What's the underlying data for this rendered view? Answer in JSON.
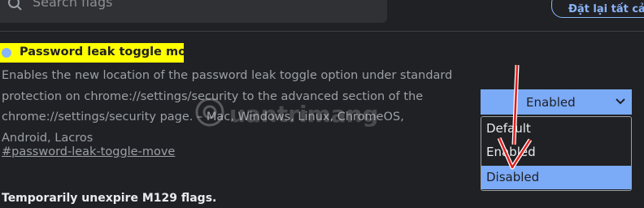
{
  "search": {
    "placeholder": "Search flags"
  },
  "header": {
    "reset_label": "Đặt lại tất cả"
  },
  "flag": {
    "title": "Password leak toggle move",
    "description": "Enables the new location of the password leak toggle option under standard protection on chrome://settings/security to the advanced section of the chrome://settings/security page. – Mac, Windows, Linux, ChromeOS, Android, Lacros",
    "link": "#password-leak-toggle-move",
    "select": {
      "value": "Enabled",
      "options": [
        "Default",
        "Enabled",
        "Disabled"
      ],
      "highlighted": "Disabled"
    }
  },
  "next_flag": {
    "title": "Temporarily unexpire M129 flags."
  },
  "watermark": {
    "text": "uantrimang"
  },
  "colors": {
    "background": "#202124",
    "accent": "#8ab4f8",
    "highlight": "#ffff00",
    "arrow": "#e02020"
  }
}
